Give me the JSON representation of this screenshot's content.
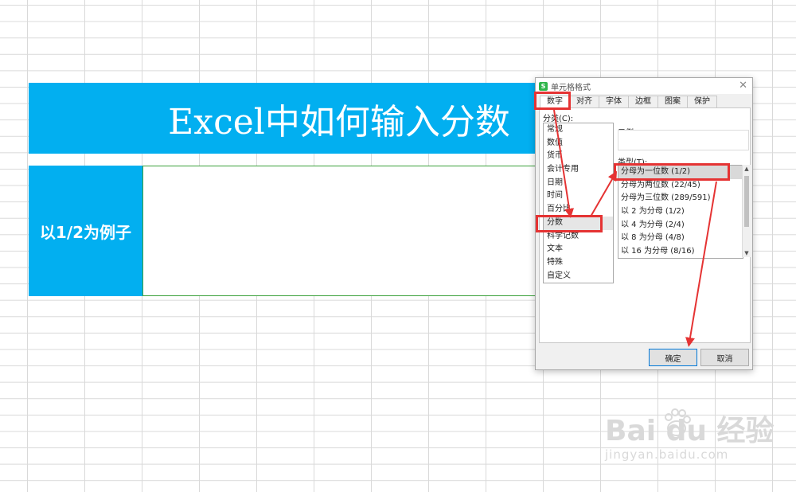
{
  "sheet": {
    "banner_title": "Excel中如何输入分数",
    "label_cell": "以1/2为例子"
  },
  "dialog": {
    "title": "单元格格式",
    "app_icon": "S",
    "tabs": [
      "数字",
      "对齐",
      "字体",
      "边框",
      "图案",
      "保护"
    ],
    "active_tab": "数字",
    "category_label": "分类(C):",
    "categories": [
      "常规",
      "数值",
      "货币",
      "会计专用",
      "日期",
      "时间",
      "百分比",
      "分数",
      "科学记数",
      "文本",
      "特殊",
      "自定义"
    ],
    "selected_category": "分数",
    "sample_label": "示例",
    "type_label": "类型(T):",
    "types": [
      "分母为一位数 (1/2)",
      "分母为两位数 (22/45)",
      "分母为三位数 (289/591)",
      "以 2 为分母 (1/2)",
      "以 4 为分母 (2/4)",
      "以 8 为分母 (4/8)",
      "以 16 为分母 (8/16)"
    ],
    "selected_type": "分母为一位数 (1/2)",
    "ok_label": "确定",
    "cancel_label": "取消"
  },
  "watermark": {
    "main": "Bai du 经验",
    "sub": "jingyan.baidu.com"
  },
  "colors": {
    "banner": "#02aff0",
    "highlight": "#e53333",
    "cell_border": "#3aa03a"
  }
}
